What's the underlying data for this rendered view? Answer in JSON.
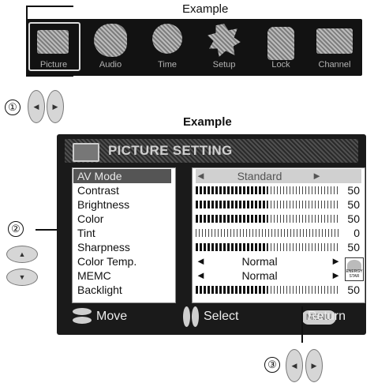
{
  "captions": {
    "top": "Example",
    "middle": "Example"
  },
  "menu_bar": {
    "items": [
      {
        "label": "Picture",
        "icon": "picture-icon"
      },
      {
        "label": "Audio",
        "icon": "audio-icon"
      },
      {
        "label": "Time",
        "icon": "time-icon"
      },
      {
        "label": "Setup",
        "icon": "setup-icon"
      },
      {
        "label": "Lock",
        "icon": "lock-icon"
      },
      {
        "label": "Channel",
        "icon": "channel-icon"
      }
    ]
  },
  "callouts": {
    "one": "①",
    "two": "②",
    "three": "③"
  },
  "osd": {
    "title": "PICTURE SETTING",
    "settings": [
      {
        "label": "AV Mode",
        "value": "Standard",
        "type": "select",
        "selected": true
      },
      {
        "label": "Contrast",
        "level": 50,
        "max": 100,
        "value": "50",
        "type": "bar"
      },
      {
        "label": "Brightness",
        "level": 50,
        "max": 100,
        "value": "50",
        "type": "bar"
      },
      {
        "label": "Color",
        "level": 50,
        "max": 100,
        "value": "50",
        "type": "bar"
      },
      {
        "label": "Tint",
        "level": 0,
        "max": 100,
        "value": "0",
        "type": "bar"
      },
      {
        "label": "Sharpness",
        "level": 50,
        "max": 100,
        "value": "50",
        "type": "bar"
      },
      {
        "label": "Color Temp.",
        "value": "Normal",
        "type": "select"
      },
      {
        "label": "MEMC",
        "value": "Normal",
        "type": "select"
      },
      {
        "label": "Backlight",
        "level": 50,
        "max": 100,
        "value": "50",
        "type": "bar"
      }
    ],
    "energy_star_text": "ENERGY STAR",
    "footer": {
      "move": "Move",
      "select": "Select",
      "menu_button": "MENU",
      "return": "Return"
    }
  },
  "colors": {
    "osd_background": "#1a1a1a",
    "menu_bar": "#121212"
  }
}
